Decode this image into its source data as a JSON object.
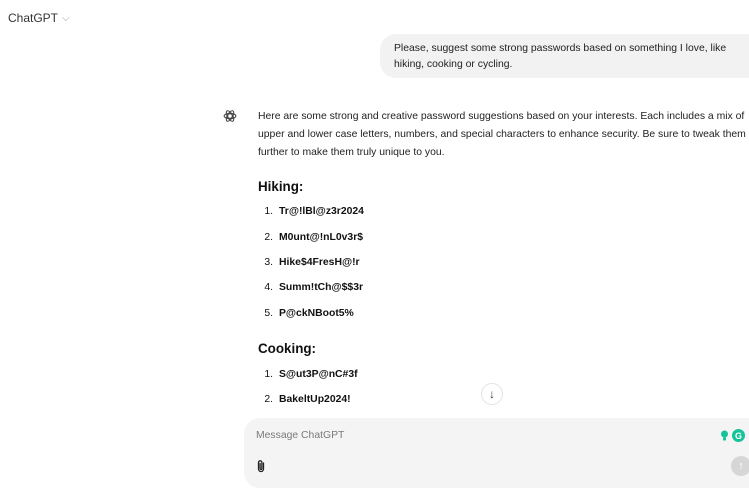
{
  "header": {
    "title": "ChatGPT",
    "chevron": "⌵"
  },
  "user_message": "Please, suggest some strong passwords based on something I love, like hiking, cooking or cycling.",
  "assistant": {
    "intro": "Here are some strong and creative password suggestions based on your interests. Each includes a mix of upper and lower case letters, numbers, and special characters to enhance security. Be sure to tweak them further to make them truly unique to you.",
    "sections": [
      {
        "heading": "Hiking:",
        "items": [
          {
            "num": "1.",
            "pw": "Tr@!lBl@z3r2024"
          },
          {
            "num": "2.",
            "pw": "M0unt@!nL0v3r$"
          },
          {
            "num": "3.",
            "pw": "Hike$4FresH@!r"
          },
          {
            "num": "4.",
            "pw": "Summ!tCh@$$3r"
          },
          {
            "num": "5.",
            "pw": "P@ckNBoot5%"
          }
        ]
      },
      {
        "heading": "Cooking:",
        "items": [
          {
            "num": "1.",
            "pw": "S@ut3P@nC#3f"
          },
          {
            "num": "2.",
            "pw": "BakeltUp2024!"
          }
        ]
      }
    ]
  },
  "composer": {
    "placeholder": "Message ChatGPT"
  },
  "icons": {
    "scroll_down": "↓",
    "send": "↑",
    "grammarly": "G"
  },
  "colors": {
    "grammarly": "#15c39a",
    "bubble": "#f2f2f2",
    "composer": "#f4f4f4"
  }
}
